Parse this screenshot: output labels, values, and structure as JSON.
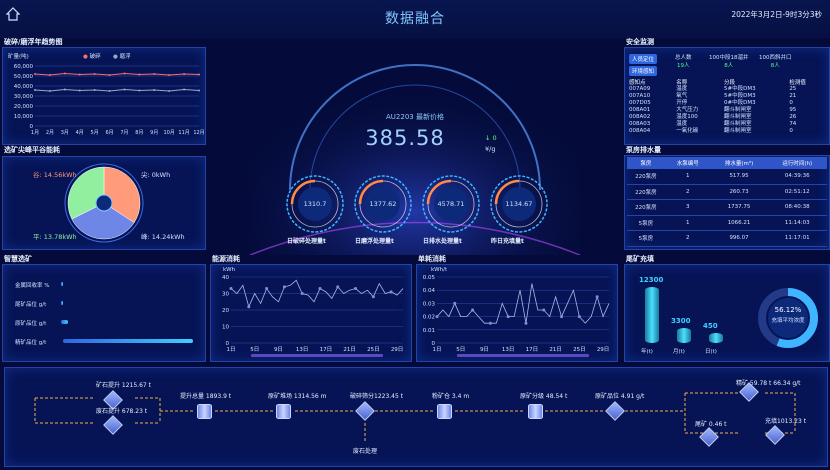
{
  "header": {
    "title": "数据融合",
    "datetime": "2022年3月2日-9时3分3秒"
  },
  "trend_panel": {
    "title": "破碎/磨浮年趋势图",
    "ylabel": "矿量(吨)",
    "legend": [
      "破碎",
      "磨浮"
    ],
    "colors": [
      "#ff6a6a",
      "#9aa7c8"
    ],
    "chart_data": {
      "type": "line",
      "categories": [
        "1月",
        "2月",
        "3月",
        "4月",
        "5月",
        "6月",
        "7月",
        "8月",
        "9月",
        "10月",
        "11月",
        "12月"
      ],
      "yticks": [
        "60,000",
        "50,000",
        "40,000",
        "30,000",
        "20,000",
        "10,000",
        "0"
      ],
      "ylim": [
        0,
        60000
      ],
      "series": [
        {
          "name": "破碎",
          "values": [
            52000,
            51000,
            52500,
            51500,
            52000,
            51000,
            52500,
            51500,
            52000,
            51000,
            52000,
            51500
          ]
        },
        {
          "name": "磨浮",
          "values": [
            36000,
            35000,
            36500,
            35500,
            36000,
            35000,
            36500,
            35500,
            36000,
            35000,
            36500,
            35500
          ]
        }
      ]
    }
  },
  "energy_panel": {
    "title": "选矿尖峰平谷能耗",
    "chart_data": {
      "type": "pie",
      "slices": [
        {
          "name": "谷",
          "value": 14.56,
          "label": "谷: 14.56kWh",
          "color": "#ff9a7a"
        },
        {
          "name": "尖",
          "value": 0,
          "label": "尖: 0kWh",
          "color": "#4a64d0"
        },
        {
          "name": "峰",
          "value": 14.24,
          "label": "峰: 14.24kWh",
          "color": "#6e86e6"
        },
        {
          "name": "平",
          "value": 13.78,
          "label": "平: 13.78kWh",
          "color": "#90f0a0"
        }
      ]
    }
  },
  "smart_panel": {
    "title": "智慧选矿",
    "items": [
      {
        "label": "金属回收率 %",
        "fill": 0.0
      },
      {
        "label": "尾矿品位 g/t",
        "fill": 0.01
      },
      {
        "label": "原矿品位 g/t",
        "fill": 0.05
      },
      {
        "label": "精矿品位 g/t",
        "fill": 1.0
      }
    ]
  },
  "center": {
    "price_title": "AU2203 最新价格",
    "price": "385.58",
    "change": "0",
    "unit": "¥/g",
    "gauges": [
      {
        "value": "1310.7",
        "label": "日破碎处理量t"
      },
      {
        "value": "1377.62",
        "label": "日磨浮处理量t"
      },
      {
        "value": "4578.71",
        "label": "日排水处理量t"
      },
      {
        "value": "1134.67",
        "label": "昨日充填量t"
      }
    ]
  },
  "consumption_panel": {
    "title": "能源消耗",
    "ylabel": "kWh",
    "chart_data": {
      "type": "line",
      "xticks": [
        "1日",
        "5日",
        "9日",
        "13日",
        "17日",
        "21日",
        "25日",
        "29日"
      ],
      "yticks": [
        "40",
        "30",
        "20",
        "10",
        "0"
      ],
      "ylim": [
        0,
        40
      ],
      "values": [
        33,
        30,
        35,
        22,
        30,
        24,
        33,
        28,
        25,
        34,
        35,
        38,
        30,
        29,
        25,
        33,
        31,
        27,
        34,
        30,
        32,
        33,
        30,
        32,
        28,
        36,
        30,
        31,
        29,
        33
      ]
    }
  },
  "unit_panel": {
    "title": "单耗消耗",
    "ylabel": "kWh/t",
    "chart_data": {
      "type": "line",
      "xticks": [
        "1日",
        "5日",
        "9日",
        "13日",
        "17日",
        "21日",
        "25日",
        "29日"
      ],
      "yticks": [
        "0.05",
        "0.04",
        "0.03",
        "0.02",
        "0.01",
        "0"
      ],
      "ylim": [
        0,
        0.05
      ],
      "values": [
        0.02,
        0.025,
        0.02,
        0.03,
        0.02,
        0.02,
        0.025,
        0.02,
        0.015,
        0.015,
        0.015,
        0.03,
        0.02,
        0.02,
        0.04,
        0.015,
        0.045,
        0.025,
        0.025,
        0.02,
        0.035,
        0.02,
        0.03,
        0.04,
        0.02,
        0.015,
        0.02,
        0.035,
        0.02,
        0.03
      ]
    }
  },
  "safety_panel": {
    "title": "安全监测",
    "tabs": [
      "人员定位",
      "环境感知"
    ],
    "stats": [
      {
        "label": "总人数",
        "value": "19人"
      },
      {
        "label": "100中段18溜井",
        "value": "8人"
      },
      {
        "label": "100西斜井口",
        "value": "8人"
      }
    ],
    "columns": [
      "感知点",
      "名称",
      "分段",
      "检测值"
    ],
    "rows": [
      [
        "007A09",
        "温度",
        "5#中段DM3",
        "25"
      ],
      [
        "007A10",
        "氧气",
        "5#中段DM3",
        "21"
      ],
      [
        "007D05",
        "开停",
        "0#中段DM3",
        "0"
      ],
      [
        "008A01",
        "大气压力",
        "翻斗制闸室",
        "95"
      ],
      [
        "008A02",
        "温度100",
        "翻斗制闸室",
        "26"
      ],
      [
        "008A03",
        "温度",
        "翻斗制闸室",
        "74"
      ],
      [
        "008A04",
        "一氧化碳",
        "翻斗制闸室",
        "0"
      ]
    ]
  },
  "pump_panel": {
    "title": "泵房排水量",
    "columns": [
      "泵房",
      "水泵编号",
      "排水量(m³)",
      "运行时间(h)"
    ],
    "rows": [
      [
        "220泵房",
        "1",
        "517.95",
        "04:39:36"
      ],
      [
        "220泵房",
        "2",
        "260.73",
        "02:51:12"
      ],
      [
        "220泵房",
        "3",
        "1737.75",
        "08:40:38"
      ],
      [
        "5泵房",
        "1",
        "1066.21",
        "11:14:03"
      ],
      [
        "5泵房",
        "2",
        "996.07",
        "11:17:01"
      ]
    ]
  },
  "fill_panel": {
    "title": "尾矿充填",
    "chart_data": {
      "type": "bar",
      "categories": [
        "年(t)",
        "月(t)",
        "日(t)"
      ],
      "values": [
        12300,
        3300,
        450
      ],
      "labels": [
        "12300",
        "3300",
        "450"
      ]
    },
    "donut_value": "56.12%",
    "donut_label": "充填平均浓度",
    "donut_fraction": 0.5612
  },
  "flow": {
    "nodes": [
      {
        "text": "矿石提升 1215.67 t"
      },
      {
        "text": "废石提升 678.23 t"
      },
      {
        "text": "提升总量 1893.9 t"
      },
      {
        "text": "原矿堆场 1314.56 m"
      },
      {
        "text": "破碎筛分1223.45 t"
      },
      {
        "text": "粉矿仓 3.4 m"
      },
      {
        "text": "原矿分级 48.54 t"
      },
      {
        "text": "原矿品位 4.91 g/t"
      },
      {
        "text": "精矿 59.78 t  66.34 g/t"
      },
      {
        "text": "尾矿 0.46 t"
      },
      {
        "text": "充填1013.23 t"
      },
      {
        "text": "废石处理"
      }
    ]
  }
}
